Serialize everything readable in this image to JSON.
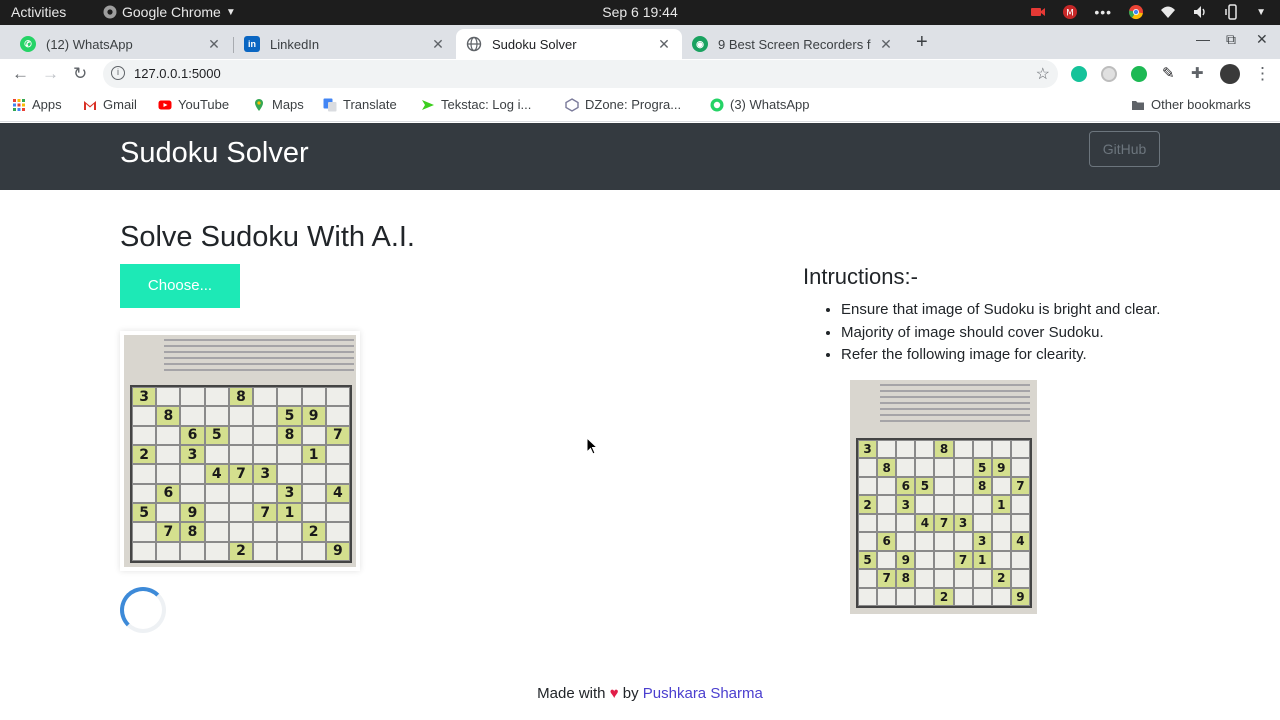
{
  "gnome": {
    "activities": "Activities",
    "app_name": "Google Chrome",
    "clock": "Sep 6  19:44"
  },
  "tabs": [
    {
      "title": "(12) WhatsApp",
      "favicon": "whatsapp-icon",
      "color": "#25d366"
    },
    {
      "title": "LinkedIn",
      "favicon": "linkedin-icon",
      "color": "#0a66c2"
    },
    {
      "title": "Sudoku Solver",
      "favicon": "globe-icon",
      "color": "#5f6368"
    },
    {
      "title": "9 Best Screen Recorders f",
      "favicon": "recorder-icon",
      "color": "#1aa260"
    }
  ],
  "address": {
    "url": "127.0.0.1:5000"
  },
  "bookmarks": {
    "items": [
      {
        "label": "Apps",
        "icon": "apps-grid-icon",
        "color": "#ea4335"
      },
      {
        "label": "Gmail",
        "icon": "gmail-icon",
        "color": "#d93025"
      },
      {
        "label": "YouTube",
        "icon": "youtube-icon",
        "color": "#ff0000"
      },
      {
        "label": "Maps",
        "icon": "maps-icon",
        "color": "#34a853"
      },
      {
        "label": "Translate",
        "icon": "translate-icon",
        "color": "#4285f4"
      },
      {
        "label": "Tekstac: Log i...",
        "icon": "tekstac-icon",
        "color": "#3ccf1e"
      },
      {
        "label": "DZone: Progra...",
        "icon": "dzone-icon",
        "color": "#7a7a9a"
      },
      {
        "label": "(3) WhatsApp",
        "icon": "whatsapp-icon",
        "color": "#25d366"
      }
    ],
    "other": "Other bookmarks"
  },
  "site": {
    "brand": "Sudoku Solver",
    "github_label": "GitHub",
    "heading": "Solve Sudoku With A.I.",
    "choose_label": "Choose...",
    "instructions_title": "Intructions:-",
    "instructions": [
      "Ensure that image of Sudoku is bright and clear.",
      "Majority of image should cover Sudoku.",
      "Refer the following image for clearity."
    ],
    "footer_prefix": "Made with ",
    "footer_heart": "♥",
    "footer_by": " by ",
    "footer_author": "Pushkara Sharma",
    "accent_color": "#1de9b6",
    "navbar_color": "#343a40"
  },
  "sudoku_puzzle": [
    [
      3,
      0,
      0,
      0,
      8,
      0,
      0,
      0,
      0
    ],
    [
      0,
      8,
      0,
      0,
      0,
      0,
      5,
      9,
      0
    ],
    [
      0,
      0,
      6,
      5,
      0,
      0,
      8,
      0,
      7
    ],
    [
      2,
      0,
      3,
      0,
      0,
      0,
      0,
      1,
      0
    ],
    [
      0,
      0,
      0,
      4,
      7,
      3,
      0,
      0,
      0
    ],
    [
      0,
      6,
      0,
      0,
      0,
      0,
      3,
      0,
      4
    ],
    [
      5,
      0,
      9,
      0,
      0,
      7,
      1,
      0,
      0
    ],
    [
      0,
      7,
      8,
      0,
      0,
      0,
      0,
      2,
      0
    ],
    [
      0,
      0,
      0,
      0,
      2,
      0,
      0,
      0,
      9
    ]
  ]
}
